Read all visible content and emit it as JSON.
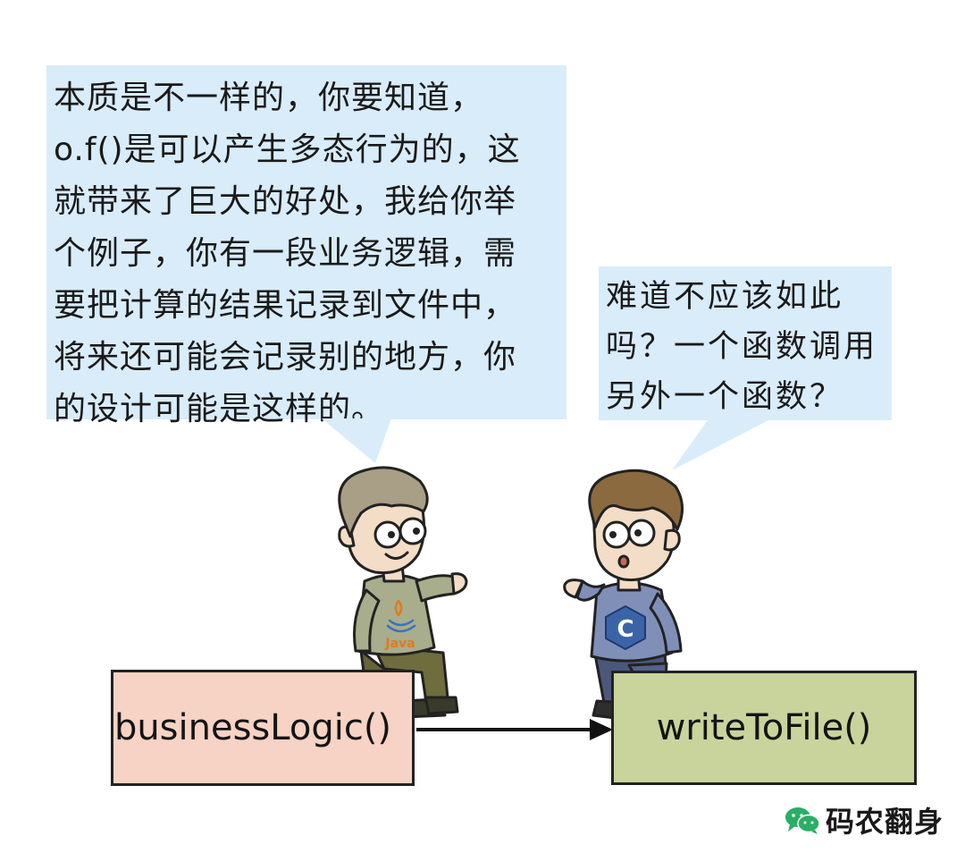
{
  "bubbles": {
    "left": {
      "lines": [
        "本质是不一样的，你要知道，",
        "o.f()是可以产生多态行为的，这",
        "就带来了巨大的好处，我给你举",
        "个例子，你有一段业务逻辑，需",
        "要把计算的结果记录到文件中，",
        "将来还可能会记录别的地方，你",
        "的设计可能是这样的。"
      ]
    },
    "right": {
      "lines": [
        "难道不应该如此",
        "吗？一个函数调用",
        "另外一个函数？"
      ]
    }
  },
  "diagram": {
    "caller": "businessLogic()",
    "callee": "writeToFile()",
    "arrow": "calls"
  },
  "characters": {
    "left": {
      "shirt_logo_text": "Java",
      "shirt_color": "#a8ad8c"
    },
    "right": {
      "shirt_logo_text": "C",
      "shirt_color": "#7f8fb8"
    }
  },
  "colors": {
    "bubble": "#d9ecf9",
    "caller_box": "#f6d3c4",
    "callee_box": "#c9d39c",
    "wechat_green": "#2aae67"
  },
  "watermark": {
    "icon": "wechat-icon",
    "text": "码农翻身"
  }
}
